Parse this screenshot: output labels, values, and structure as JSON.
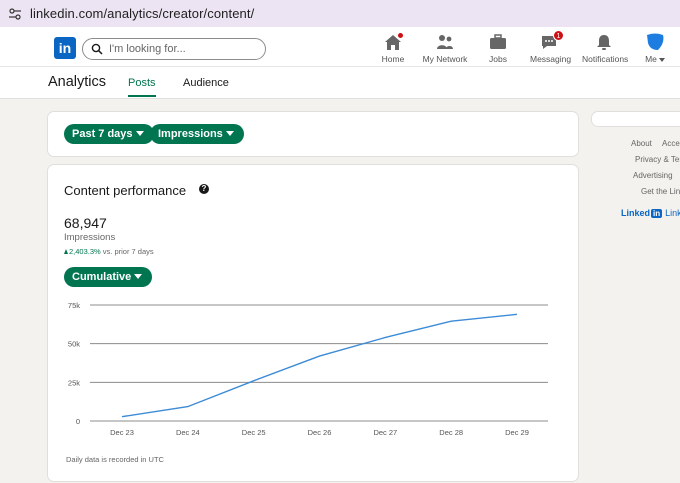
{
  "browser": {
    "url": "linkedin.com/analytics/creator/content/"
  },
  "nav": {
    "logo": "in",
    "search_placeholder": "I'm looking for...",
    "items": [
      {
        "label": "Home",
        "icon": "home-icon",
        "badge": ""
      },
      {
        "label": "My Network",
        "icon": "network-icon",
        "badge": ""
      },
      {
        "label": "Jobs",
        "icon": "briefcase-icon",
        "badge": ""
      },
      {
        "label": "Messaging",
        "icon": "messaging-icon",
        "badge": "1"
      },
      {
        "label": "Notifications",
        "icon": "bell-icon",
        "badge": ""
      },
      {
        "label": "Me",
        "icon": "avatar-icon",
        "badge": ""
      }
    ]
  },
  "subhead": {
    "title": "Analytics",
    "tabs": [
      {
        "label": "Posts",
        "active": true
      },
      {
        "label": "Audience",
        "active": false
      }
    ]
  },
  "filters": {
    "range_label": "Past 7 days",
    "metric_label": "Impressions"
  },
  "performance": {
    "title": "Content performance",
    "total": "68,947",
    "total_label": "Impressions",
    "change": "2,403.3%",
    "change_suffix": "vs. prior 7 days",
    "mode_label": "Cumulative",
    "footnote": "Daily data is recorded in UTC"
  },
  "chart_data": {
    "type": "line",
    "x": [
      "Dec 23",
      "Dec 24",
      "Dec 25",
      "Dec 26",
      "Dec 27",
      "Dec 28",
      "Dec 29"
    ],
    "series": [
      {
        "values": [
          2800,
          9300,
          26000,
          42000,
          54000,
          64500,
          68947
        ]
      }
    ],
    "y_ticks": [
      "0",
      "25k",
      "50k",
      "75k"
    ],
    "ylim": [
      0,
      75000
    ],
    "grid": true,
    "line_color": "#3d8bd6"
  },
  "right_rail": {
    "links": [
      "About",
      "Acces",
      "Privacy & Ter",
      "Advertising",
      "Get the Lin"
    ],
    "brand": "Linked",
    "brand_in": "in",
    "brand_rest": "Linked"
  },
  "colors": {
    "brand": "#0a66c2",
    "accent": "#01754f",
    "badge": "#cc1016"
  }
}
